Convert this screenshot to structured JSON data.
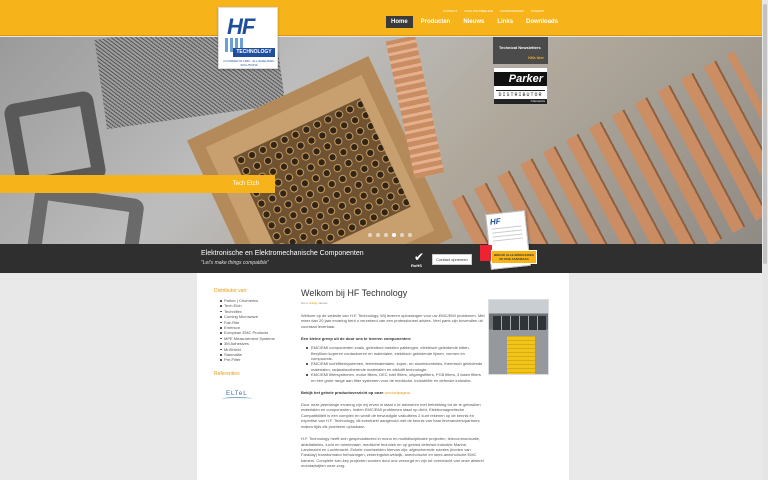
{
  "header": {
    "logo": {
      "brand": "HF",
      "name": "TECHNOLOGY",
      "tagline": "FOUNDED IN 1993 · ALL SHIELDING SOLUTIONS"
    },
    "top_links": [
      "Contact",
      "Kwaliteitsbeleid",
      "Voorwaarden",
      "Sitemap"
    ],
    "nav": [
      {
        "label": "Home",
        "active": true
      },
      {
        "label": "Producten",
        "active": false
      },
      {
        "label": "Nieuws",
        "active": false
      },
      {
        "label": "Links",
        "active": false
      },
      {
        "label": "Downloads",
        "active": false
      }
    ]
  },
  "hero": {
    "caption": "Tech Etch",
    "slides": 6,
    "active_slide": 4,
    "newsletter": {
      "title": "Technical Newsletters",
      "link": "Klik hier"
    },
    "parker": {
      "brand": "Parker",
      "label": "DISTRIBUTOR",
      "sub": "Chomerics"
    }
  },
  "banner": {
    "line1": "Elektronische en Elektromechanische Componenten",
    "line2": "\"Let's make things compatible\"",
    "rohs": "RoHS",
    "contact": "Contact opnemen",
    "brochure": {
      "logo": "HF",
      "cta": "BEKIJK ALLE BROCHURES OF DOE AANVRAAG"
    }
  },
  "sidebar": {
    "heading": "Distributor van:",
    "items": [
      "Parker | Chomerics",
      "Tech Etch",
      "Techniflex",
      "Coming Microwave",
      "Fair-Rite",
      "Emerson",
      "European EMC Products",
      "MPE Measurement Systems",
      "3M Adhesives",
      "MuShield",
      "Stannalite",
      "Pre-Filter"
    ],
    "references_heading": "Referenties",
    "reference_logo": "ELTeL"
  },
  "content": {
    "title": "Welkom bij HF Technology",
    "meta_prefix": "Nu is",
    "meta_link": "Huidig",
    "meta_suffix": "nieuws",
    "intro": "Welkom op de website van H.F. Technology. Wij leveren oplossingen voor uw EMC/EMI problemen. Met meer dan 20 jaar ervaring bent u verzekerd van een professioneel advies. Veel parts zijn bovendien uit voorraad leverbaar.",
    "list_heading": "Een kleine greep uit de door ons te leveren componenten:",
    "list": [
      "EMC/EMI componenten zoals, geleidend metalen pakkingen, elektrisch geleidende kitten, Beryllium koperen contactveren en materialen, elektrisch geleidende lijmen, vormen en compounds.",
      "EMC/EMI luchtfilterisystemen, ferrietmaterialen, koper- en aluminiumfolies, thermisch geleidende materialen, radarabsorberende materialen en afsluitfi technologie.",
      "EMC/EMI filtersystemen, motor filters, DEC inlet filters, uitgangsfilters, PCB filters, 3 fasen filters en een grote range aan filter systemen voor de medische, industriële en defensie industrie."
    ],
    "cta_text": "Bekijk het gehele productoverzicht op onze",
    "cta_link": "productpagina.",
    "para2": "Door onze jarenlange ervaring zijn wij ervan in staat u te adviseren met betrekking tot de te gebruiken materialen en componenten. Indien EMC/EMI problemen staat op dicht, Elektromagnetische Compatibiliteit is een complex en wordt de bewustigde valkuiltens 2 kunt rekenen op de kennis en expertise van H.F. Technology, dit eventueel aangevuld met de kennis van haar leveranciers/partners maken tijds elk probleem oplosbaar.",
    "para3": "H.F. Technology heeft zich gespecialiseerd in mono en multidisciplinaire projecten, telecommunicatie, afdeltatieleis, lucht en ruimtevaart, medische techniek en op gebied defensie industrie Marine, Landmacht en Luchtmacht. Enkele voorbeelden hiervan zijn: afgeschermde ruimtes (kooien van Faraday) transformator behuizingen, zekeringsheuvelwijk, anechoïsche en semi-anechoïsche EMC kamers. Complete turn-key projecten worden door ons verzorgd en zijn tot overdracht van onze afwerel mondadwijten onze zorg."
  }
}
